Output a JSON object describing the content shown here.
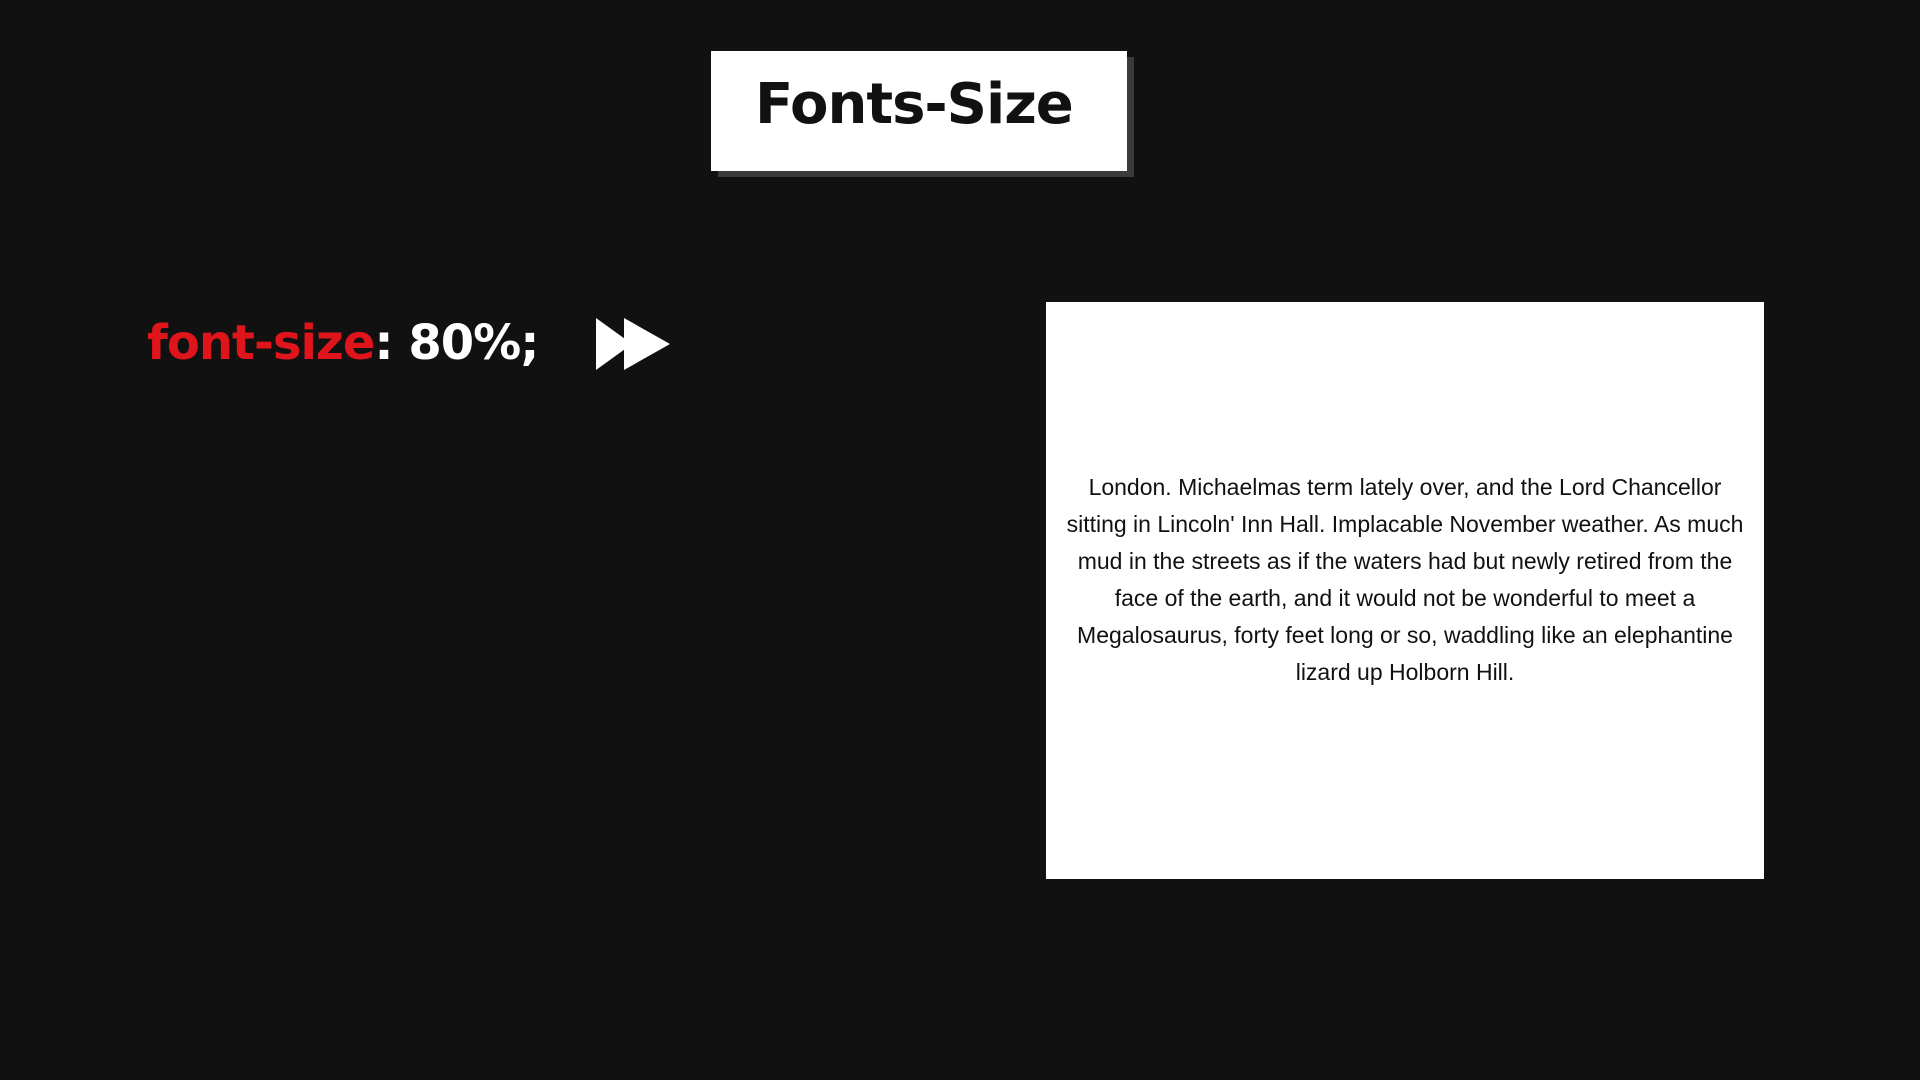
{
  "title": "Fonts-Size",
  "code": {
    "property": "font-size",
    "colon": ":",
    "value": " 80%;"
  },
  "icons": {
    "arrow": "fast-forward-icon"
  },
  "colors": {
    "background": "#111111",
    "property": "#e0141b",
    "value": "#ffffff",
    "card": "#ffffff"
  },
  "preview": {
    "text": "London. Michaelmas term lately over, and the Lord Chancellor sitting in Lincoln' Inn Hall. Implacable November weather. As much mud in the streets as if the waters had but newly retired from the face of the earth, and it would not be wonderful to meet a Megalosaurus, forty feet long or so, waddling like an elephantine lizard up Holborn Hill."
  }
}
